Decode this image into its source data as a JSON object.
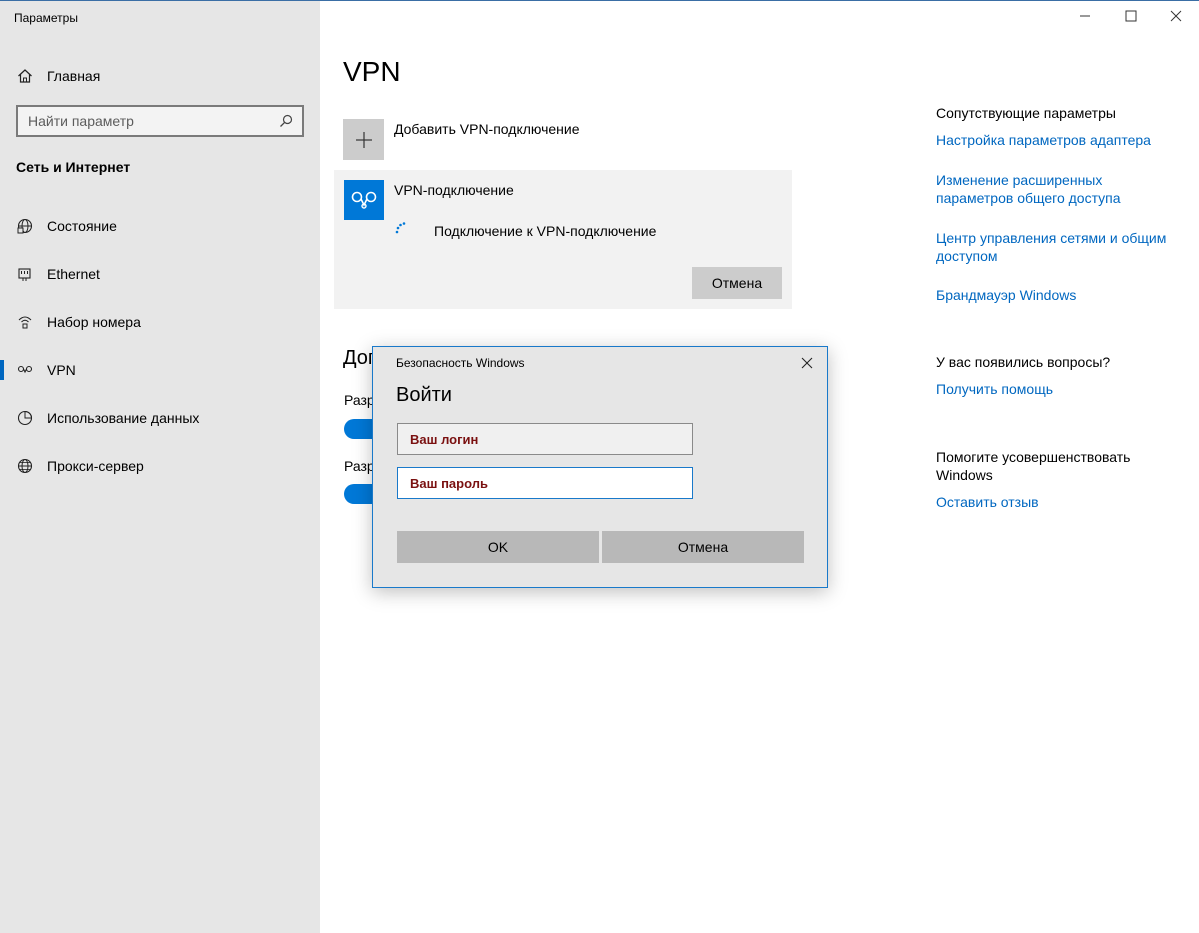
{
  "window": {
    "title": "Параметры",
    "minimize_glyph": "—",
    "maximize_glyph": "☐",
    "close_glyph": "✕"
  },
  "sidebar": {
    "home_label": "Главная",
    "home_icon": "home-icon",
    "search_placeholder": "Найти параметр",
    "search_value": "",
    "section_title": "Сеть и Интернет",
    "items": [
      {
        "label": "Состояние",
        "icon": "globe-status-icon",
        "active": false
      },
      {
        "label": "Ethernet",
        "icon": "ethernet-icon",
        "active": false
      },
      {
        "label": "Набор номера",
        "icon": "dialup-icon",
        "active": false
      },
      {
        "label": "VPN",
        "icon": "vpn-icon",
        "active": true
      },
      {
        "label": "Использование данных",
        "icon": "data-usage-icon",
        "active": false
      },
      {
        "label": "Прокси-сервер",
        "icon": "globe-icon",
        "active": false
      }
    ]
  },
  "main": {
    "title": "VPN",
    "add_label": "Добавить VPN-подключение",
    "vpn": {
      "name": "VPN-подключение",
      "status": "Подключение к VPN-подключение",
      "cancel_label": "Отмена"
    },
    "advanced": {
      "heading_fragment": "Доп",
      "option1_fragment": "Разр",
      "option2_fragment": "Разр"
    }
  },
  "related": {
    "heading": "Сопутствующие параметры",
    "links": [
      "Настройка параметров адаптера",
      "Изменение расширенных параметров общего доступа",
      "Центр управления сетями и общим доступом",
      "Брандмауэр Windows"
    ],
    "questions_heading": "У вас появились вопросы?",
    "help_link": "Получить помощь",
    "improve_heading": "Помогите усовершенствовать Windows",
    "feedback_link": "Оставить отзыв"
  },
  "dialog": {
    "title": "Безопасность Windows",
    "heading": "Войти",
    "login_placeholder": "Ваш логин",
    "password_placeholder": "Ваш пароль",
    "ok_label": "OK",
    "cancel_label": "Отмена"
  },
  "colors": {
    "accent": "#0078d7",
    "link": "#0067c0",
    "sidebar_bg": "#e6e6e6",
    "placeholder_text": "#7a1010"
  }
}
